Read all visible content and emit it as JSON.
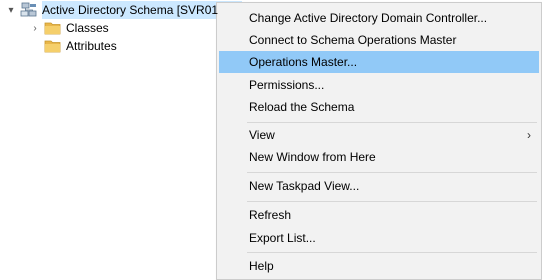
{
  "tree": {
    "root": {
      "label": "Active Directory Schema [SVR01",
      "expander": "▾",
      "icon": "schema-snapin-icon"
    },
    "children": [
      {
        "label": "Classes",
        "expander": "›",
        "icon": "folder-icon"
      },
      {
        "label": "Attributes",
        "icon": "folder-icon"
      }
    ]
  },
  "context_menu": {
    "items": [
      {
        "label": "Change Active Directory Domain Controller..."
      },
      {
        "label": "Connect to Schema Operations Master"
      },
      {
        "label": "Operations Master...",
        "highlighted": true
      },
      {
        "label": "Permissions..."
      },
      {
        "label": "Reload the Schema"
      },
      {
        "label": "View",
        "submenu_arrow": "›"
      },
      {
        "label": "New Window from Here"
      },
      {
        "label": "New Taskpad View..."
      },
      {
        "label": "Refresh"
      },
      {
        "label": "Export List..."
      },
      {
        "label": "Help"
      }
    ]
  },
  "colors": {
    "selection": "#cce8ff",
    "menu_background": "#f2f2f2",
    "menu_highlight": "#91c9f7",
    "folder": "#e8b64a"
  }
}
